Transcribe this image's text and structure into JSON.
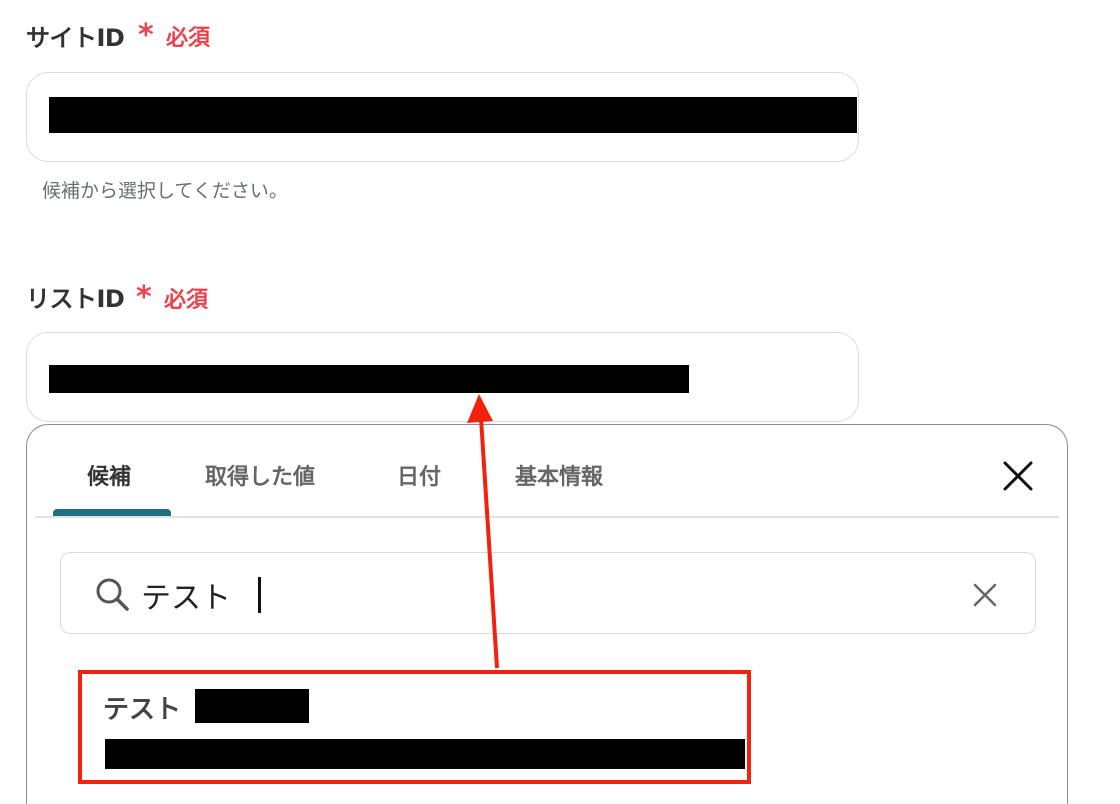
{
  "site_field": {
    "label": "サイトID",
    "required_star": "*",
    "required_text": "必須",
    "hint": "候補から選択してください。"
  },
  "list_field": {
    "label": "リストID",
    "required_star": "*",
    "required_text": "必須"
  },
  "picker": {
    "tabs": [
      {
        "label": "候補",
        "active": true
      },
      {
        "label": "取得した値",
        "active": false
      },
      {
        "label": "日付",
        "active": false
      },
      {
        "label": "基本情報",
        "active": false
      }
    ],
    "search_value": "テスト",
    "results": [
      {
        "title": "テスト"
      }
    ]
  },
  "colors": {
    "required": "#e8434e",
    "tab_accent": "#1f7182",
    "annotation": "#f2220f"
  },
  "icons": [
    "close-icon",
    "search-icon",
    "clear-icon",
    "arrow-annotation"
  ]
}
